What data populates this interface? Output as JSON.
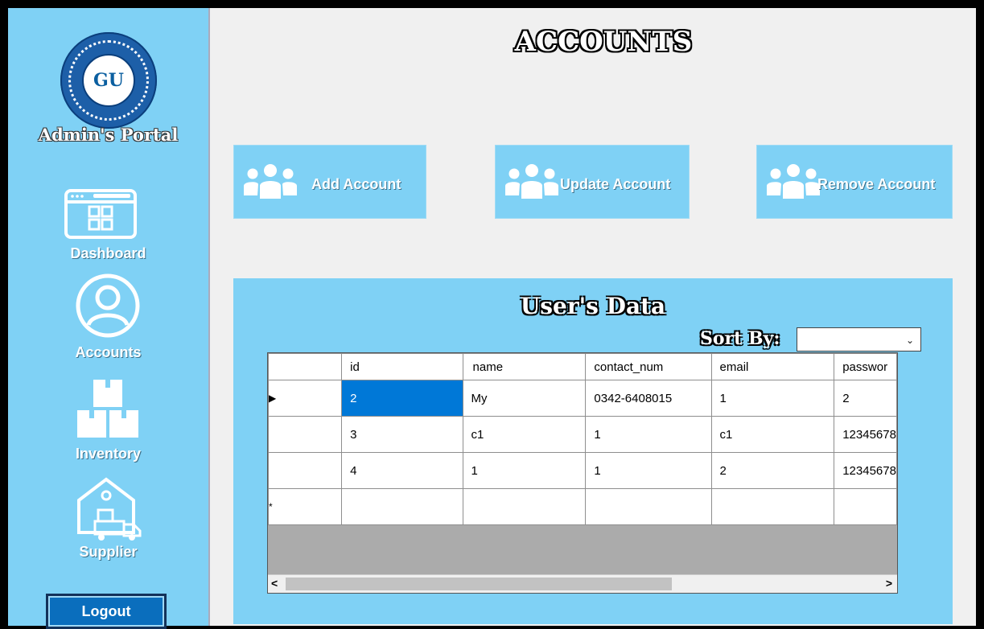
{
  "sidebar": {
    "portal_title": "Admin's Portal",
    "logo_text": "GU",
    "nav": [
      {
        "label": "Dashboard",
        "icon": "dashboard-window-icon"
      },
      {
        "label": "Accounts",
        "icon": "user-circle-icon"
      },
      {
        "label": "Inventory",
        "icon": "boxes-icon"
      },
      {
        "label": "Supplier",
        "icon": "warehouse-truck-icon"
      }
    ],
    "logout_label": "Logout"
  },
  "main": {
    "title": "ACCOUNTS",
    "actions": [
      {
        "label": "Add Account",
        "icon": "users-group-icon"
      },
      {
        "label": "Update Account",
        "icon": "users-group-icon"
      },
      {
        "label": "Remove Account",
        "icon": "users-group-icon"
      }
    ]
  },
  "data_panel": {
    "title": "User's Data",
    "sort_label": "Sort By:",
    "sort_value": "",
    "columns": [
      "id",
      "name",
      "contact_num",
      "email",
      "passwor"
    ],
    "rows": [
      {
        "marker": "▶",
        "cells": [
          "2",
          "My",
          "0342-6408015",
          "1",
          "2"
        ]
      },
      {
        "marker": "",
        "cells": [
          "3",
          "c1",
          "1",
          "c1",
          "12345678"
        ]
      },
      {
        "marker": "",
        "cells": [
          "4",
          "1",
          "1",
          "2",
          "12345678"
        ]
      },
      {
        "marker": "*",
        "cells": [
          "",
          "",
          "",
          "",
          ""
        ]
      }
    ]
  },
  "colors": {
    "sidebar_bg": "#7fd1f5",
    "selected_cell": "#0078d7",
    "logout_bg": "#0a6ebd"
  }
}
